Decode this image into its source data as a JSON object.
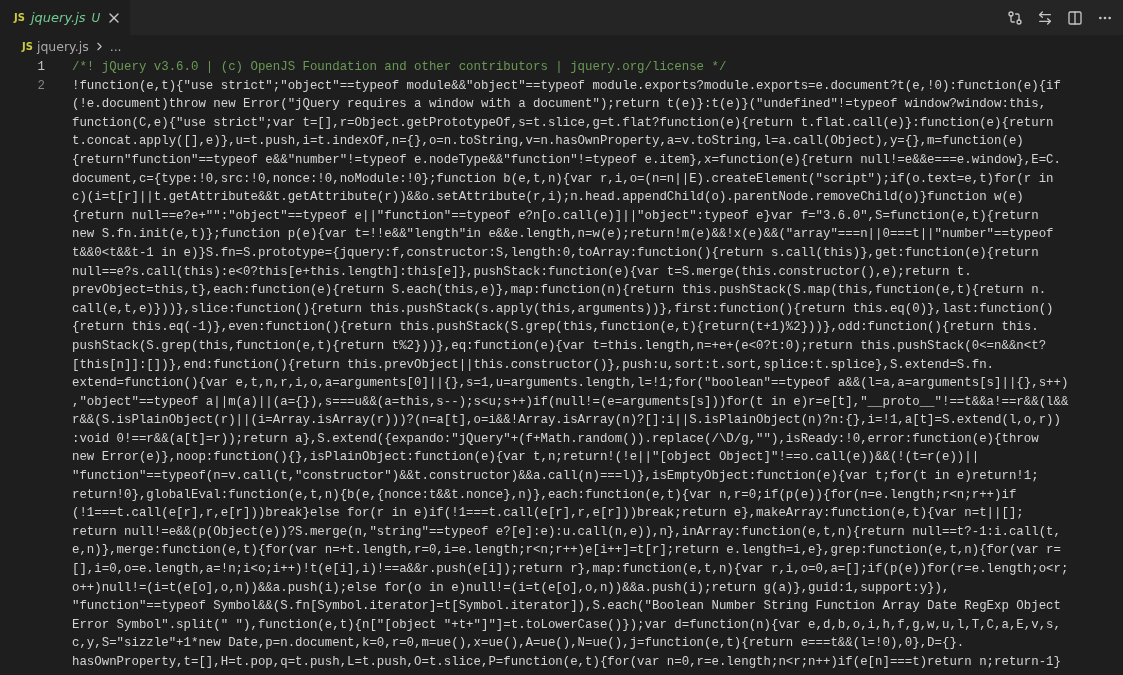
{
  "tabs": [
    {
      "badge": "JS",
      "name": "jquery.js",
      "status": "U",
      "selected": true
    }
  ],
  "breadcrumb": {
    "badge": "JS",
    "items": [
      "jquery.js",
      "..."
    ]
  },
  "editor": {
    "lines": [
      {
        "number": "1",
        "kind": "comment",
        "current": true,
        "rows": [
          "/*! jQuery v3.6.0 | (c) OpenJS Foundation and other contributors | jquery.org/license */"
        ]
      },
      {
        "number": "2",
        "kind": "code",
        "current": false,
        "rows": [
          "!function(e,t){\"use strict\";\"object\"==typeof module&&\"object\"==typeof module.exports?module.exports=e.document?t(e,!0):function(e){if",
          "(!e.document)throw new Error(\"jQuery requires a window with a document\");return t(e)}:t(e)}(\"undefined\"!=typeof window?window:this,",
          "function(C,e){\"use strict\";var t=[],r=Object.getPrototypeOf,s=t.slice,g=t.flat?function(e){return t.flat.call(e)}:function(e){return",
          "t.concat.apply([],e)},u=t.push,i=t.indexOf,n={},o=n.toString,v=n.hasOwnProperty,a=v.toString,l=a.call(Object),y={},m=function(e)",
          "{return\"function\"==typeof e&&\"number\"!=typeof e.nodeType&&\"function\"!=typeof e.item},x=function(e){return null!=e&&e===e.window},E=C.",
          "document,c={type:!0,src:!0,nonce:!0,noModule:!0};function b(e,t,n){var r,i,o=(n=n||E).createElement(\"script\");if(o.text=e,t)for(r in",
          "c)(i=t[r]||t.getAttribute&&t.getAttribute(r))&&o.setAttribute(r,i);n.head.appendChild(o).parentNode.removeChild(o)}function w(e)",
          "{return null==e?e+\"\":\"object\"==typeof e||\"function\"==typeof e?n[o.call(e)]||\"object\":typeof e}var f=\"3.6.0\",S=function(e,t){return",
          "new S.fn.init(e,t)};function p(e){var t=!!e&&\"length\"in e&&e.length,n=w(e);return!m(e)&&!x(e)&&(\"array\"===n||0===t||\"number\"==typeof",
          "t&&0<t&&t-1 in e)}S.fn=S.prototype={jquery:f,constructor:S,length:0,toArray:function(){return s.call(this)},get:function(e){return",
          "null==e?s.call(this):e<0?this[e+this.length]:this[e]},pushStack:function(e){var t=S.merge(this.constructor(),e);return t.",
          "prevObject=this,t},each:function(e){return S.each(this,e)},map:function(n){return this.pushStack(S.map(this,function(e,t){return n.",
          "call(e,t,e)}))},slice:function(){return this.pushStack(s.apply(this,arguments))},first:function(){return this.eq(0)},last:function()",
          "{return this.eq(-1)},even:function(){return this.pushStack(S.grep(this,function(e,t){return(t+1)%2}))},odd:function(){return this.",
          "pushStack(S.grep(this,function(e,t){return t%2}))},eq:function(e){var t=this.length,n=+e+(e<0?t:0);return this.pushStack(0<=n&&n<t?",
          "[this[n]]:[])},end:function(){return this.prevObject||this.constructor()},push:u,sort:t.sort,splice:t.splice},S.extend=S.fn.",
          "extend=function(){var e,t,n,r,i,o,a=arguments[0]||{},s=1,u=arguments.length,l=!1;for(\"boolean\"==typeof a&&(l=a,a=arguments[s]||{},s++)",
          ",\"object\"==typeof a||m(a)||(a={}),s===u&&(a=this,s--);s<u;s++)if(null!=(e=arguments[s]))for(t in e)r=e[t],\"__proto__\"!==t&&a!==r&&(l&&",
          "r&&(S.isPlainObject(r)||(i=Array.isArray(r)))?(n=a[t],o=i&&!Array.isArray(n)?[]:i||S.isPlainObject(n)?n:{},i=!1,a[t]=S.extend(l,o,r))",
          ":void 0!==r&&(a[t]=r));return a},S.extend({expando:\"jQuery\"+(f+Math.random()).replace(/\\D/g,\"\"),isReady:!0,error:function(e){throw",
          "new Error(e)},noop:function(){},isPlainObject:function(e){var t,n;return!(!e||\"[object Object]\"!==o.call(e))&&(!(t=r(e))||",
          "\"function\"==typeof(n=v.call(t,\"constructor\")&&t.constructor)&&a.call(n)===l)},isEmptyObject:function(e){var t;for(t in e)return!1;",
          "return!0},globalEval:function(e,t,n){b(e,{nonce:t&&t.nonce},n)},each:function(e,t){var n,r=0;if(p(e)){for(n=e.length;r<n;r++)if",
          "(!1===t.call(e[r],r,e[r]))break}else for(r in e)if(!1===t.call(e[r],r,e[r]))break;return e},makeArray:function(e,t){var n=t||[];",
          "return null!=e&&(p(Object(e))?S.merge(n,\"string\"==typeof e?[e]:e):u.call(n,e)),n},inArray:function(e,t,n){return null==t?-1:i.call(t,",
          "e,n)},merge:function(e,t){for(var n=+t.length,r=0,i=e.length;r<n;r++)e[i++]=t[r];return e.length=i,e},grep:function(e,t,n){for(var r=",
          "[],i=0,o=e.length,a=!n;i<o;i++)!t(e[i],i)!==a&&r.push(e[i]);return r},map:function(e,t,n){var r,i,o=0,a=[];if(p(e))for(r=e.length;o<r;",
          "o++)null!=(i=t(e[o],o,n))&&a.push(i);else for(o in e)null!=(i=t(e[o],o,n))&&a.push(i);return g(a)},guid:1,support:y}),",
          "\"function\"==typeof Symbol&&(S.fn[Symbol.iterator]=t[Symbol.iterator]),S.each(\"Boolean Number String Function Array Date RegExp Object",
          "Error Symbol\".split(\" \"),function(e,t){n[\"[object \"+t+\"]\"]=t.toLowerCase()});var d=function(n){var e,d,b,o,i,h,f,g,w,u,l,T,C,a,E,v,s,",
          "c,y,S=\"sizzle\"+1*new Date,p=n.document,k=0,r=0,m=ue(),x=ue(),A=ue(),N=ue(),j=function(e,t){return e===t&&(l=!0),0},D={}.",
          "hasOwnProperty,t=[],H=t.pop,q=t.push,L=t.push,O=t.slice,P=function(e,t){for(var n=0,r=e.length;n<r;n++)if(e[n]===t)return n;return-1}"
        ]
      }
    ]
  }
}
